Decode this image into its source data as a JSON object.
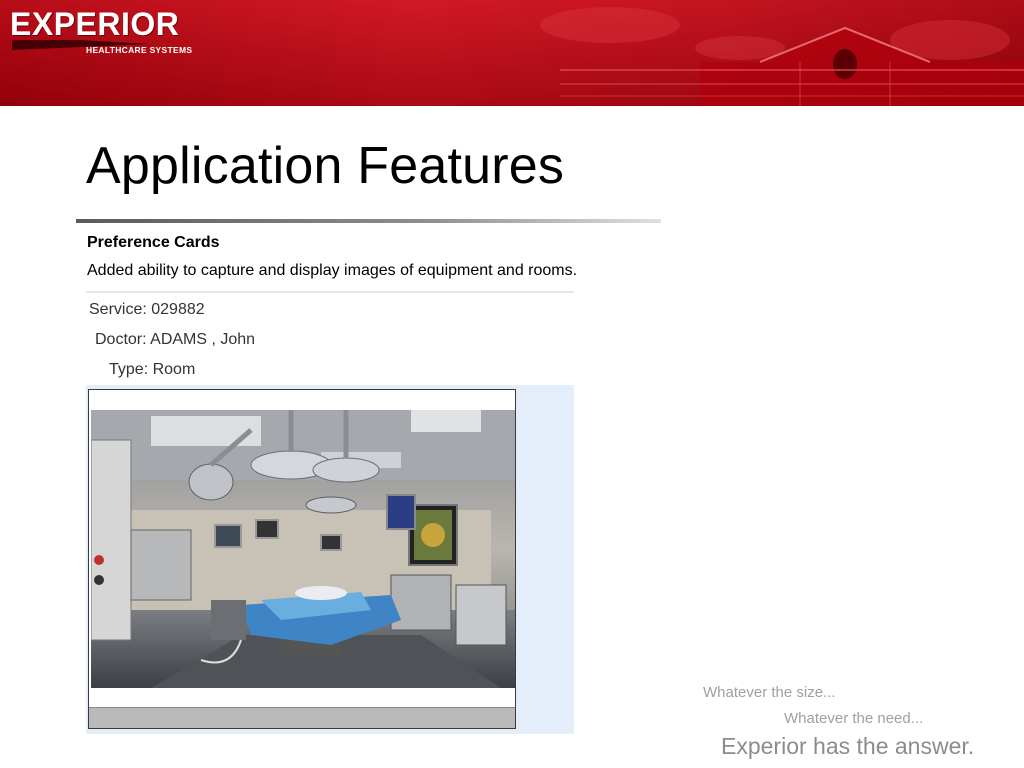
{
  "header": {
    "logo_text": "EXPERIOR",
    "logo_subtitle": "HEALTHCARE SYSTEMS",
    "brand_color": "#c80a14"
  },
  "slide": {
    "title": "Application Features",
    "subheading": "Preference Cards",
    "description": "Added ability to capture and display images of equipment and rooms."
  },
  "card": {
    "service_label": "Service:",
    "service_value": "029882",
    "doctor_label": "Doctor:",
    "doctor_value": "ADAMS , John",
    "type_label": "Type:",
    "type_value": "Room",
    "image_subject": "operating-room-photo"
  },
  "tagline": {
    "line1": "Whatever the size...",
    "line2": "Whatever the need...",
    "line3": "Experior has the answer."
  }
}
